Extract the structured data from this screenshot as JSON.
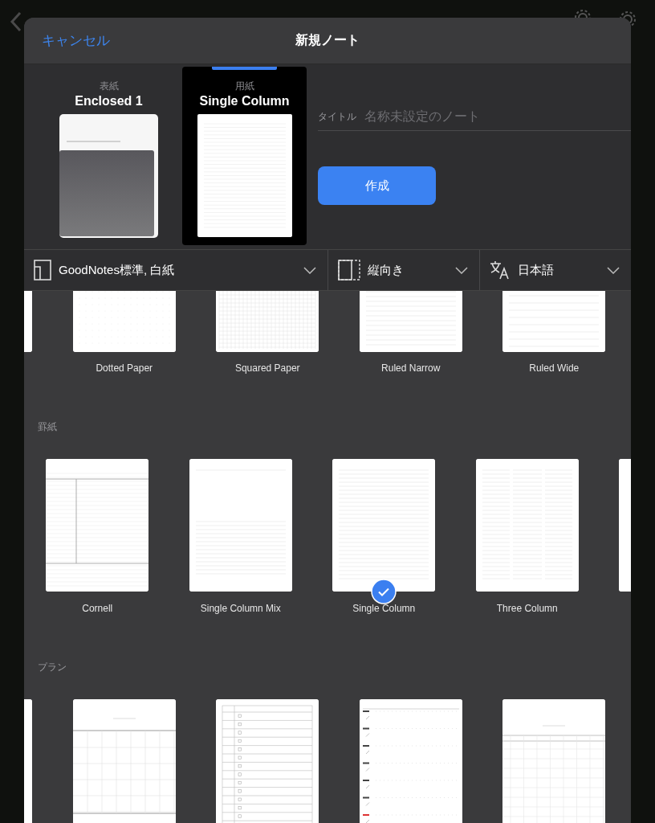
{
  "dialog": {
    "cancel": "キャンセル",
    "title": "新規ノート"
  },
  "preview": {
    "cards": [
      {
        "kind": "cover",
        "caption": "表紙",
        "name": "Enclosed 1",
        "selected": false
      },
      {
        "kind": "paper",
        "caption": "用紙",
        "name": "Single Column",
        "selected": true
      }
    ],
    "title_label": "タイトル",
    "title_placeholder": "名称未設定のノート",
    "create": "作成"
  },
  "toolbar": [
    {
      "kind": "template",
      "label": "GoodNotes標準, 白紙"
    },
    {
      "kind": "orientation",
      "label": "縦向き"
    },
    {
      "kind": "language",
      "label": "日本語"
    }
  ],
  "sections": [
    {
      "items": [
        {
          "kind": "plain"
        },
        {
          "kind": "dotted",
          "label": "Dotted Paper",
          "selected": false
        },
        {
          "kind": "squared",
          "label": "Squared Paper",
          "selected": false
        },
        {
          "kind": "ruled-narrow",
          "label": "Ruled Narrow",
          "selected": false
        },
        {
          "kind": "ruled-wide",
          "label": "Ruled Wide",
          "selected": false
        }
      ]
    },
    {
      "header": "罫紙",
      "items": [
        {
          "kind": "cornell",
          "label": "Cornell",
          "selected": false
        },
        {
          "kind": "single-mix",
          "label": "Single Column Mix",
          "selected": false
        },
        {
          "kind": "single",
          "label": "Single Column",
          "selected": true
        },
        {
          "kind": "three",
          "label": "Three Column",
          "selected": false
        },
        {
          "kind": "plain"
        }
      ]
    },
    {
      "header": "プラン",
      "items": [
        {
          "kind": "plain"
        },
        {
          "kind": "planner-grid",
          "selected": false
        },
        {
          "kind": "checklist",
          "selected": false
        },
        {
          "kind": "weekly",
          "selected": false
        },
        {
          "kind": "monthly",
          "selected": false
        }
      ]
    }
  ]
}
